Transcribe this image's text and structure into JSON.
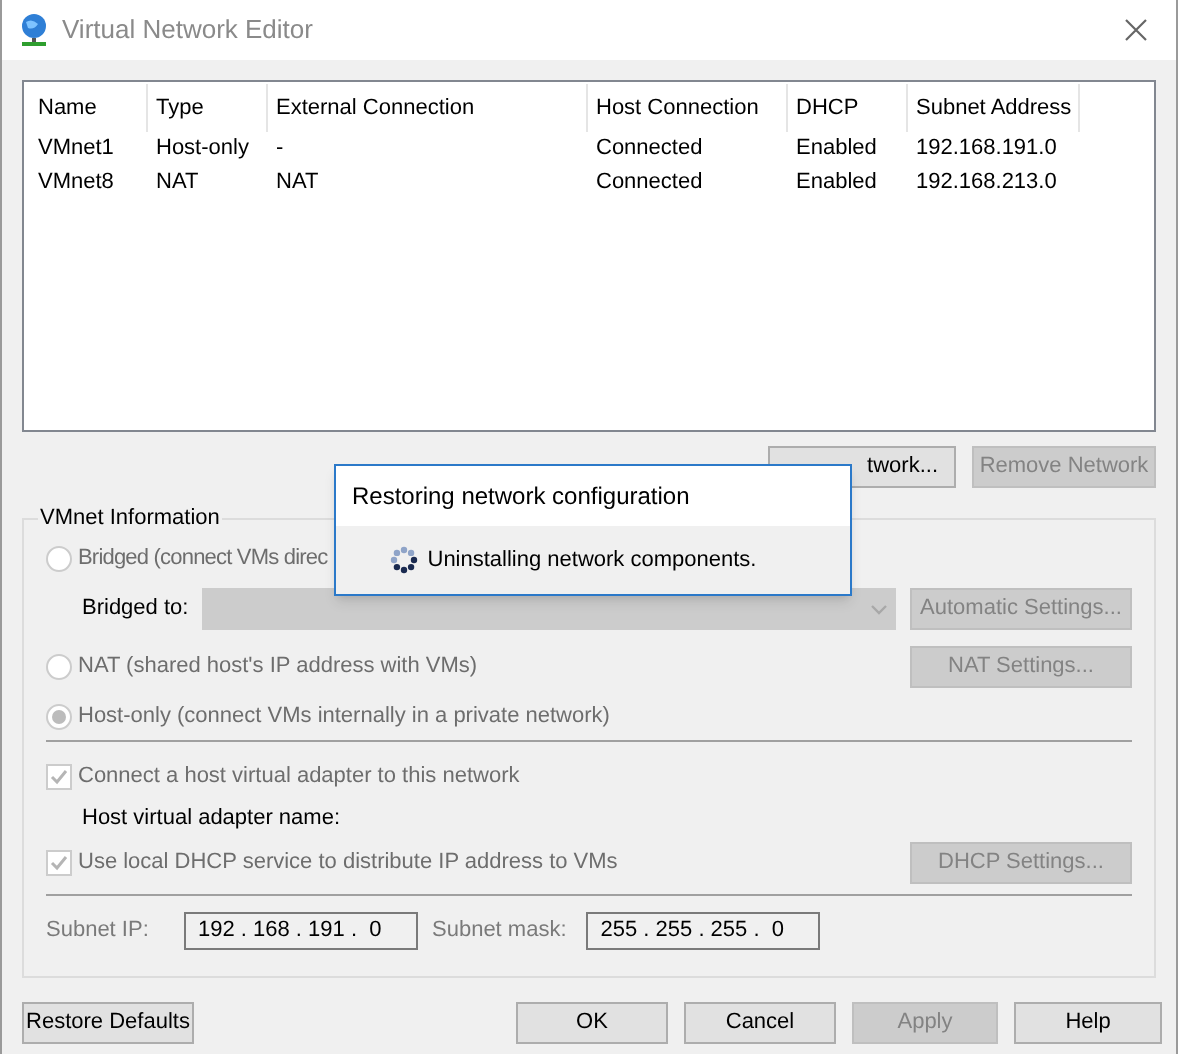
{
  "window": {
    "title": "Virtual Network Editor"
  },
  "table": {
    "columns": [
      "Name",
      "Type",
      "External Connection",
      "Host Connection",
      "DHCP",
      "Subnet Address"
    ],
    "rows": [
      [
        "VMnet1",
        "Host-only",
        "-",
        "Connected",
        "Enabled",
        "192.168.191.0"
      ],
      [
        "VMnet8",
        "NAT",
        "NAT",
        "Connected",
        "Enabled",
        "192.168.213.0"
      ]
    ]
  },
  "network_buttons": [
    {
      "label": "twork...",
      "disabled": false
    },
    {
      "label": "Remove Network",
      "disabled": true
    }
  ],
  "vmnet_info": {
    "title": "VMnet Information",
    "bridged": {
      "label": "Bridged (connect VMs direc",
      "selected": false,
      "disabled": true
    },
    "bridged_to": {
      "label": "Bridged to:",
      "disabled": true,
      "button": {
        "label": "Automatic Settings...",
        "disabled": true
      }
    },
    "nat": {
      "label": "NAT (shared host's IP address with VMs)",
      "selected": false,
      "disabled": true,
      "button": {
        "label": "NAT Settings...",
        "disabled": true
      }
    },
    "host_only": {
      "label": "Host-only (connect VMs internally in a private network)",
      "selected": true,
      "disabled": true
    },
    "connect_adapter": {
      "label": "Connect a host virtual adapter to this network",
      "checked": true,
      "disabled": true
    },
    "adapter_name_label": "Host virtual adapter name:",
    "dhcp": {
      "label": "Use local DHCP service to distribute IP address to VMs",
      "checked": true,
      "disabled": true,
      "button": {
        "label": "DHCP Settings...",
        "disabled": true
      }
    },
    "subnet_ip": {
      "label": "Subnet IP:",
      "value": "192 . 168 . 191 .  0"
    },
    "subnet_mask": {
      "label": "Subnet mask:",
      "value": "255 . 255 . 255 .  0"
    }
  },
  "modal": {
    "title": "Restoring network configuration",
    "message": "Uninstalling network components."
  },
  "footer_buttons": [
    {
      "label": "Restore Defaults",
      "disabled": false
    },
    {
      "label": "OK",
      "disabled": false
    },
    {
      "label": "Cancel",
      "disabled": false
    },
    {
      "label": "Apply",
      "disabled": true
    },
    {
      "label": "Help",
      "disabled": false
    }
  ]
}
